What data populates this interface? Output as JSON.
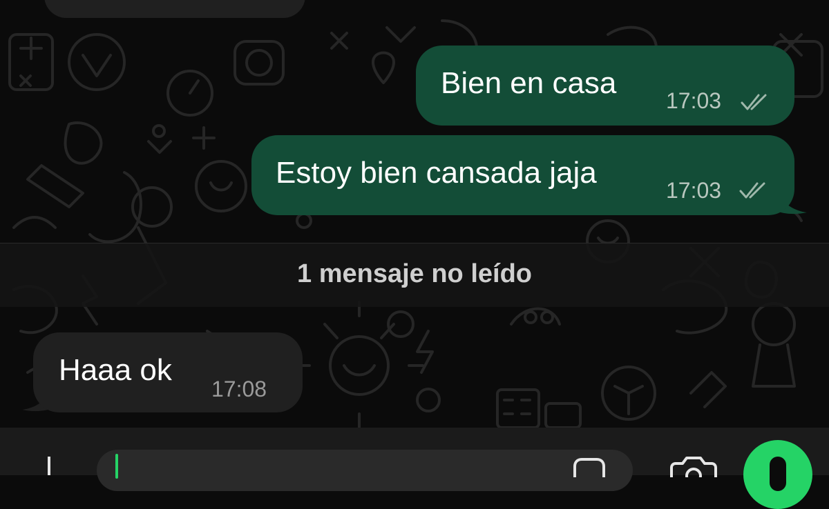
{
  "chat": {
    "messages": [
      {
        "direction": "outgoing",
        "text": "Bien en casa",
        "time": "17:03",
        "status": "read"
      },
      {
        "direction": "outgoing",
        "text": "Estoy bien cansada jaja",
        "time": "17:03",
        "status": "read"
      },
      {
        "direction": "incoming",
        "text": "Haaa ok",
        "time": "17:08"
      }
    ],
    "unread_divider": "1 mensaje no leído"
  },
  "composer": {
    "icons": {
      "attach": "plus-icon",
      "sticker": "sticker-icon",
      "camera": "camera-icon",
      "mic": "microphone-icon"
    }
  },
  "colors": {
    "outgoing_bubble": "#134d37",
    "incoming_bubble": "#202020",
    "accent": "#25d366",
    "background": "#0b0b0b"
  }
}
